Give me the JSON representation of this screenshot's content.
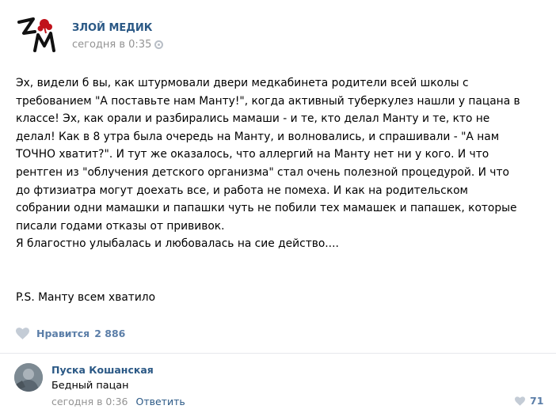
{
  "post": {
    "author": "ЗЛОЙ МЕДИК",
    "time": "сегодня в 0:35",
    "logo_text": "ЗМ",
    "text_lines": [
      "Эх, видели б вы, как штурмовали двери медкабинета родители всей школы с",
      "требованием \"А поставьте нам Манту!\", когда активный туберкулез нашли у пацана в",
      "классе! Эх, как орали и разбирались мамаши - и те, кто делал Манту и те, кто не",
      "делал! Как в 8 утра была очередь на Манту, и волновались, и спрашивали - \"А нам",
      "ТОЧНО хватит?\". И тут же оказалось, что аллергий на Манту нет ни у кого. И что",
      "рентген из \"облучения детского организма\" стал очень полезной процедурой. И что",
      "до фтизиатра могут доехать все, и работа не помеха. И как на родительском",
      "собрании одни мамашки и папашки чуть не побили тех мамашек и папашек, которые",
      "писали годами отказы от прививок.",
      "Я благостно улыбалась и любовалась на сие действо...."
    ],
    "ps": "P.S. Манту всем хватило",
    "like_label": "Нравится",
    "like_count": "2 886"
  },
  "comment": {
    "author": "Пуска Кошанская",
    "text": "Бедный пацан",
    "time": "сегодня в 0:36",
    "reply_label": "Ответить",
    "like_count": "71"
  },
  "colors": {
    "link": "#2a5885",
    "muted": "#939393",
    "like": "#5b7ea8",
    "heart": "#c4ccd6",
    "logo_red": "#c0121b"
  },
  "icons": [
    "settings-gear-icon",
    "heart-icon"
  ]
}
